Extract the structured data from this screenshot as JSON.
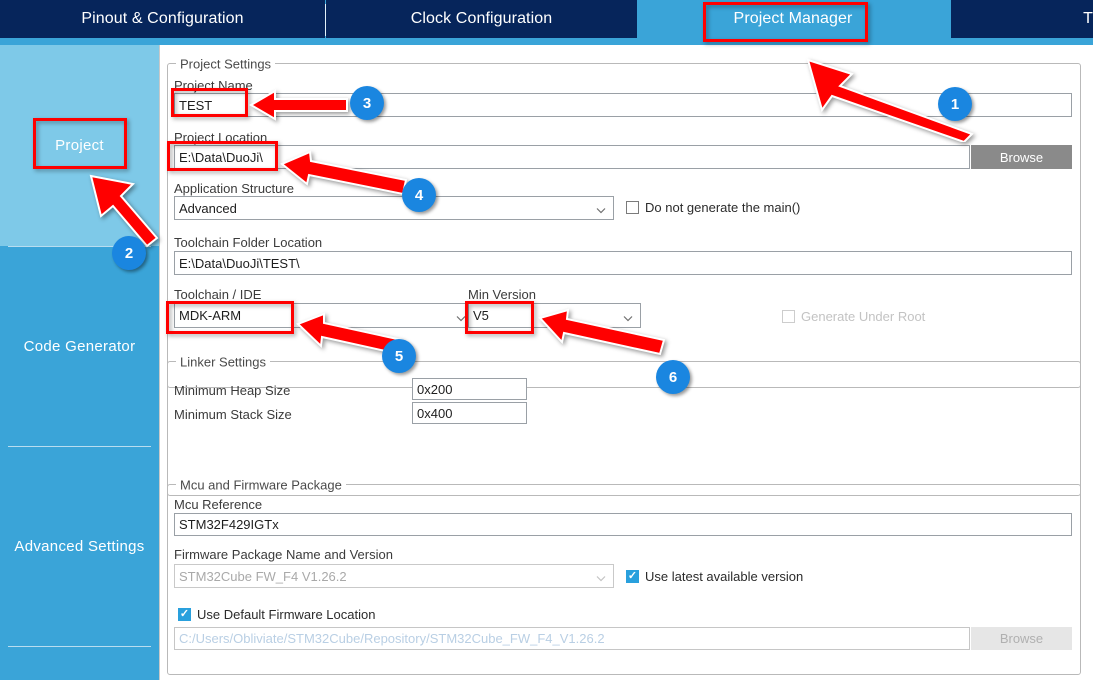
{
  "app": {
    "name": "STM32CubeMX Project Manager"
  },
  "tabs": [
    {
      "label": "Pinout & Configuration",
      "state": "inactive"
    },
    {
      "label": "Clock Configuration",
      "state": "inactive"
    },
    {
      "label": "Project Manager",
      "state": "active"
    },
    {
      "label": "T",
      "state": "inactive"
    }
  ],
  "sidebar": {
    "items": [
      {
        "label": "Project",
        "selected": true
      },
      {
        "label": "Code Generator",
        "selected": false
      },
      {
        "label": "Advanced Settings",
        "selected": false
      },
      {
        "label": "",
        "selected": false
      }
    ]
  },
  "project_settings": {
    "group_title": "Project Settings",
    "project_name_label": "Project Name",
    "project_name_value": "TEST",
    "project_location_label": "Project Location",
    "project_location_value": "E:\\Data\\DuoJi\\",
    "browse_label": "Browse",
    "application_structure_label": "Application Structure",
    "application_structure_value": "Advanced",
    "do_not_generate_main_label": "Do not generate the main()",
    "do_not_generate_main_checked": false,
    "toolchain_folder_label": "Toolchain Folder Location",
    "toolchain_folder_value": "E:\\Data\\DuoJi\\TEST\\",
    "toolchain_ide_label": "Toolchain / IDE",
    "toolchain_ide_value": "MDK-ARM",
    "min_version_label": "Min Version",
    "min_version_value": "V5",
    "generate_under_root_label": "Generate Under Root",
    "generate_under_root_checked": false,
    "generate_under_root_disabled": true
  },
  "linker_settings": {
    "group_title": "Linker Settings",
    "min_heap_label": "Minimum Heap Size",
    "min_heap_value": "0x200",
    "min_stack_label": "Minimum Stack Size",
    "min_stack_value": "0x400"
  },
  "mcu_firmware": {
    "group_title": "Mcu and Firmware Package",
    "mcu_reference_label": "Mcu Reference",
    "mcu_reference_value": "STM32F429IGTx",
    "firmware_package_label": "Firmware Package Name and Version",
    "firmware_package_value": "STM32Cube FW_F4 V1.26.2",
    "use_latest_label": "Use latest available version",
    "use_latest_checked": true,
    "use_default_location_label": "Use Default Firmware Location",
    "use_default_location_checked": true,
    "firmware_location_value": "C:/Users/Obliviate/STM32Cube/Repository/STM32Cube_FW_F4_V1.26.2",
    "browse_label": "Browse"
  },
  "annotations": {
    "accent_color": "#1a86e0",
    "highlight_color": "#ff0000",
    "badges": [
      {
        "number": "1"
      },
      {
        "number": "2"
      },
      {
        "number": "3"
      },
      {
        "number": "4"
      },
      {
        "number": "5"
      },
      {
        "number": "6"
      }
    ]
  },
  "colors": {
    "tab_inactive_bg": "#06255b",
    "tab_active_bg": "#3aa4d8",
    "sidebar_bg": "#3aa4d8",
    "sidebar_selected_bg": "#7ec9e8",
    "checkbox_checked": "#29a0dd",
    "browse_button": "#8a8a8a"
  }
}
